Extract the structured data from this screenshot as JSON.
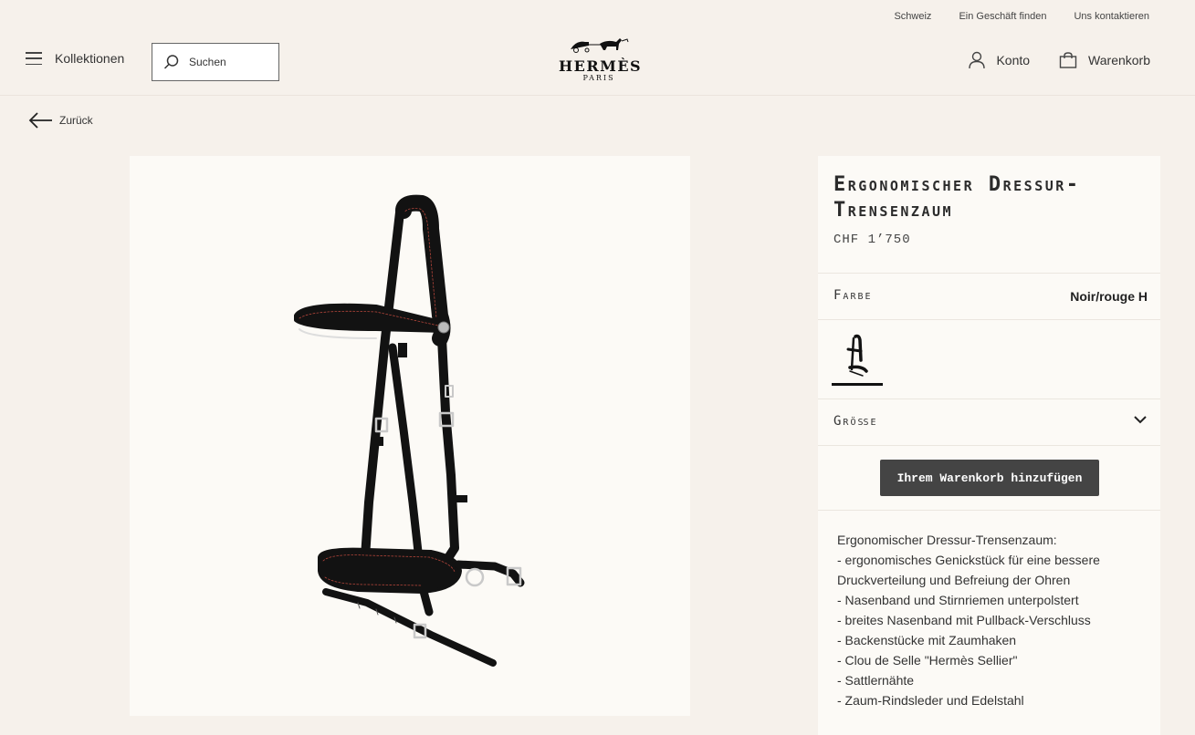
{
  "utility": {
    "country": "Schweiz",
    "find_store": "Ein Geschäft finden",
    "contact": "Uns kontaktieren"
  },
  "header": {
    "menu_label": "Kollektionen",
    "search_placeholder": "Suchen",
    "logo_word": "HERMÈS",
    "logo_sub": "PARIS",
    "account_label": "Konto",
    "cart_label": "Warenkorb"
  },
  "nav": {
    "back_label": "Zurück"
  },
  "product": {
    "title": "Ergonomischer Dressur-Trensenzaum",
    "price": "CHF 1’750",
    "color_label": "Farbe",
    "color_value": "Noir/rouge H",
    "size_label": "Größe",
    "add_to_cart": "Ihrem Warenkorb hinzufügen",
    "description": [
      "Ergonomischer Dressur-Trensenzaum:",
      "- ergonomisches Genickstück für eine bessere",
      "Druckverteilung und Befreiung der Ohren",
      "- Nasenband und Stirnriemen unterpolstert",
      "- breites Nasenband mit Pullback-Verschluss",
      "- Backenstücke mit Zaumhaken",
      "- Clou de Selle \"Hermès Sellier\"",
      "- Sattlernähte",
      "- Zaum-Rindsleder und Edelstahl"
    ]
  },
  "icons": {
    "menu": "hamburger-icon",
    "search": "search-icon",
    "account": "person-icon",
    "cart": "bag-icon",
    "back": "arrow-left-icon",
    "size_toggle": "chevron-down-icon"
  },
  "colors": {
    "background": "#f6f1eb",
    "panel": "#fcfaf6",
    "button": "#444444",
    "leather": "#121212",
    "stitch": "#b3453a"
  }
}
